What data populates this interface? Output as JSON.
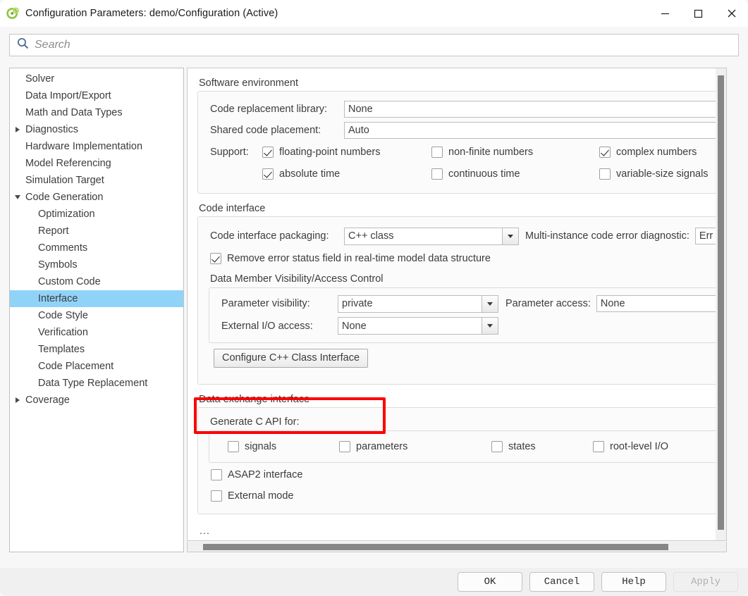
{
  "window": {
    "title": "Configuration Parameters: demo/Configuration (Active)",
    "app_icon": "simulink-icon",
    "minimize_label": "–",
    "maximize_label": "□",
    "close_label": "✕"
  },
  "search": {
    "placeholder": "Search",
    "value": "",
    "icon": "search-icon"
  },
  "sidebar": {
    "items": [
      {
        "label": "Solver",
        "level": 0,
        "twisty": "none",
        "selected": false
      },
      {
        "label": "Data Import/Export",
        "level": 0,
        "twisty": "none",
        "selected": false
      },
      {
        "label": "Math and Data Types",
        "level": 0,
        "twisty": "none",
        "selected": false
      },
      {
        "label": "Diagnostics",
        "level": 0,
        "twisty": "collapsed",
        "selected": false
      },
      {
        "label": "Hardware Implementation",
        "level": 0,
        "twisty": "none",
        "selected": false
      },
      {
        "label": "Model Referencing",
        "level": 0,
        "twisty": "none",
        "selected": false
      },
      {
        "label": "Simulation Target",
        "level": 0,
        "twisty": "none",
        "selected": false
      },
      {
        "label": "Code Generation",
        "level": 0,
        "twisty": "expanded",
        "selected": false
      },
      {
        "label": "Optimization",
        "level": 1,
        "twisty": "none",
        "selected": false
      },
      {
        "label": "Report",
        "level": 1,
        "twisty": "none",
        "selected": false
      },
      {
        "label": "Comments",
        "level": 1,
        "twisty": "none",
        "selected": false
      },
      {
        "label": "Symbols",
        "level": 1,
        "twisty": "none",
        "selected": false
      },
      {
        "label": "Custom Code",
        "level": 1,
        "twisty": "none",
        "selected": false
      },
      {
        "label": "Interface",
        "level": 1,
        "twisty": "none",
        "selected": true
      },
      {
        "label": "Code Style",
        "level": 1,
        "twisty": "none",
        "selected": false
      },
      {
        "label": "Verification",
        "level": 1,
        "twisty": "none",
        "selected": false
      },
      {
        "label": "Templates",
        "level": 1,
        "twisty": "none",
        "selected": false
      },
      {
        "label": "Code Placement",
        "level": 1,
        "twisty": "none",
        "selected": false
      },
      {
        "label": "Data Type Replacement",
        "level": 1,
        "twisty": "none",
        "selected": false
      },
      {
        "label": "Coverage",
        "level": 0,
        "twisty": "collapsed",
        "selected": false
      }
    ]
  },
  "software_environment": {
    "title": "Software environment",
    "code_replacement_library_label": "Code replacement library:",
    "code_replacement_library_value": "None",
    "shared_code_placement_label": "Shared code placement:",
    "shared_code_placement_value": "Auto",
    "support_label": "Support:",
    "checkboxes": [
      {
        "label": "floating-point numbers",
        "checked": true
      },
      {
        "label": "non-finite numbers",
        "checked": false
      },
      {
        "label": "complex numbers",
        "checked": true
      },
      {
        "label": "absolute time",
        "checked": true
      },
      {
        "label": "continuous time",
        "checked": false
      },
      {
        "label": "variable-size signals",
        "checked": false
      }
    ]
  },
  "code_interface": {
    "title": "Code interface",
    "packaging_label": "Code interface packaging:",
    "packaging_value": "C++ class",
    "multi_instance_label": "Multi-instance code error diagnostic:",
    "multi_instance_value": "Err",
    "remove_error_status": {
      "label": "Remove error status field in real-time model data structure",
      "checked": true
    },
    "visibility_group_title": "Data Member Visibility/Access Control",
    "parameter_visibility_label": "Parameter visibility:",
    "parameter_visibility_value": "private",
    "parameter_access_label": "Parameter access:",
    "parameter_access_value": "None",
    "external_io_access_label": "External I/O access:",
    "external_io_access_value": "None",
    "configure_button_label": "Configure C++ Class Interface",
    "highlight_color": "#fd0000"
  },
  "data_exchange": {
    "title": "Data exchange interface",
    "generate_c_api_label": "Generate C API for:",
    "api_checkboxes": [
      {
        "label": "signals",
        "checked": false
      },
      {
        "label": "parameters",
        "checked": false
      },
      {
        "label": "states",
        "checked": false
      },
      {
        "label": "root-level I/O",
        "checked": false
      }
    ],
    "asap2": {
      "label": "ASAP2 interface",
      "checked": false
    },
    "external_mode": {
      "label": "External mode",
      "checked": false
    },
    "more_ellipsis": "..."
  },
  "footer": {
    "buttons": [
      {
        "label": "OK",
        "disabled": false
      },
      {
        "label": "Cancel",
        "disabled": false
      },
      {
        "label": "Help",
        "disabled": false
      },
      {
        "label": "Apply",
        "disabled": true
      }
    ]
  }
}
